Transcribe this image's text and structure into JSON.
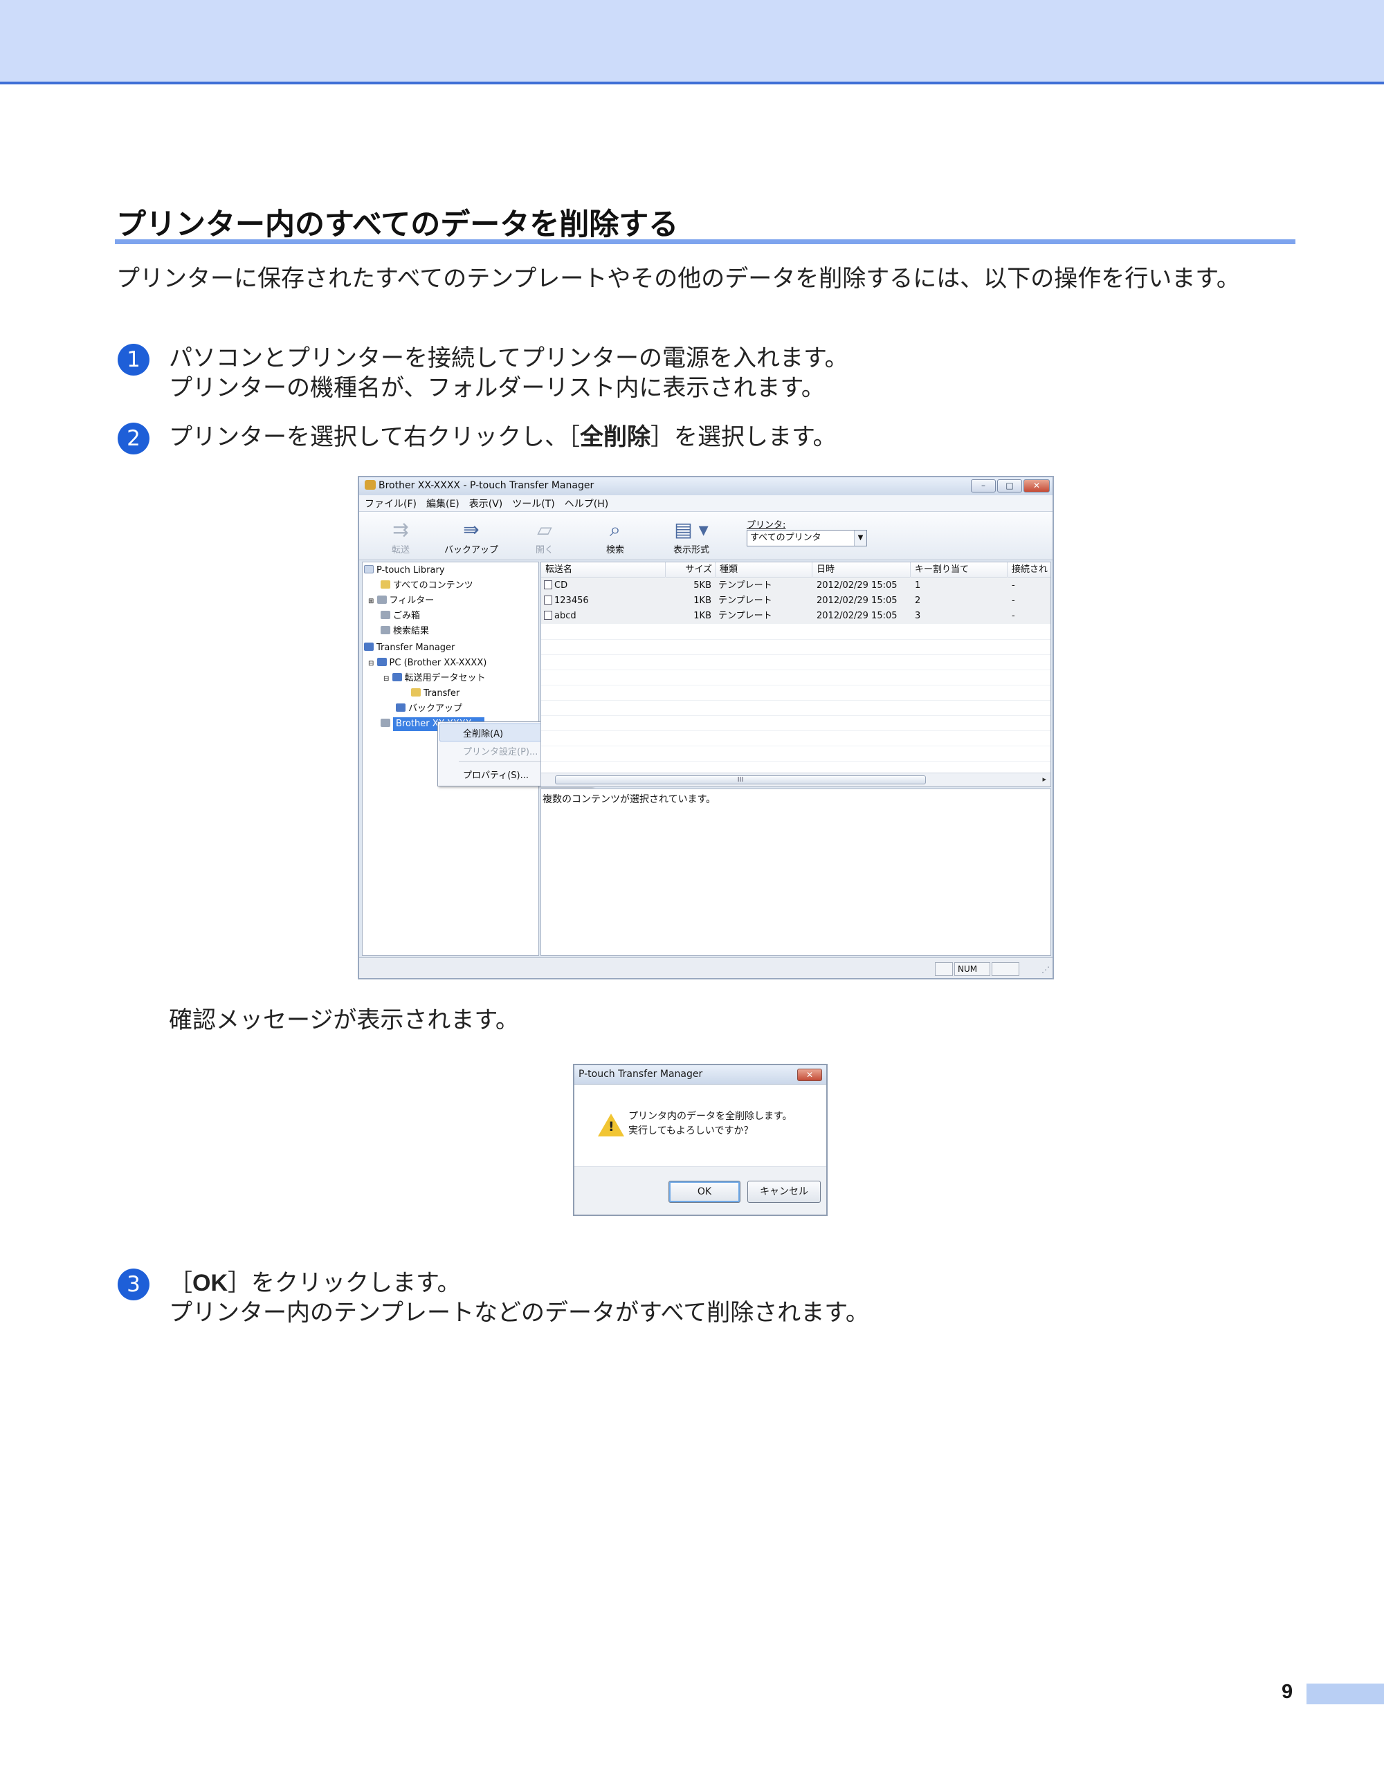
{
  "page": {
    "title": "プリンター内のすべてのデータを削除する",
    "intro": "プリンターに保存されたすべてのテンプレートやその他のデータを削除するには、以下の操作を行います。",
    "page_number": "9"
  },
  "steps": [
    {
      "num": "1",
      "line1": "パソコンとプリンターを接続してプリンターの電源を入れます。",
      "line2": "プリンターの機種名が、フォルダーリスト内に表示されます。"
    },
    {
      "num": "2",
      "pre": "プリンターを選択して右クリックし、［",
      "bold": "全削除",
      "post": "］を選択します。"
    },
    {
      "num": "3",
      "pre": "［",
      "bold": "OK",
      "post": "］をクリックします。",
      "line2": "プリンター内のテンプレートなどのデータがすべて削除されます。"
    }
  ],
  "confirm_text": "確認メッセージが表示されます。",
  "app": {
    "window_title": "Brother XX-XXXX - P-touch Transfer Manager",
    "window_buttons": [
      "–",
      "□",
      "✕"
    ],
    "menu": [
      "ファイル(F)",
      "編集(E)",
      "表示(V)",
      "ツール(T)",
      "ヘルプ(H)"
    ],
    "toolbar": {
      "transfer": "転送",
      "backup": "バックアップ",
      "open": "開く",
      "search": "検索",
      "view": "表示形式",
      "printer_label": "プリンタ:",
      "printer_value": "すべてのプリンタ"
    },
    "tree": {
      "library": "P-touch Library",
      "all_contents": "すべてのコンテンツ",
      "filter": "フィルター",
      "trash": "ごみ箱",
      "search_results": "検索結果",
      "transfer_manager": "Transfer Manager",
      "pc": "PC (Brother XX-XXXX)",
      "dataset": "転送用データセット",
      "transfer": "Transfer",
      "backup": "バックアップ",
      "printer": "Brother XX-XXXX"
    },
    "context_menu": {
      "delete_all": "全削除(A)",
      "printer_settings": "プリンタ設定(P)...",
      "properties": "プロパティ(S)..."
    },
    "list": {
      "columns": [
        "転送名",
        "サイズ",
        "種類",
        "日時",
        "キー割り当て",
        "接続され"
      ],
      "rows": [
        [
          "CD",
          "5KB",
          "テンプレート",
          "2012/02/29 15:05",
          "1",
          "-"
        ],
        [
          "123456",
          "1KB",
          "テンプレート",
          "2012/02/29 15:05",
          "2",
          "-"
        ],
        [
          "abcd",
          "1KB",
          "テンプレート",
          "2012/02/29 15:05",
          "3",
          "-"
        ]
      ],
      "scroll_grip": "III"
    },
    "detail_text": "複数のコンテンツが選択されています。",
    "status_num": "NUM"
  },
  "dialog": {
    "title": "P-touch Transfer Manager",
    "close": "✕",
    "message_line1": "プリンタ内のデータを全削除します。",
    "message_line2": "実行してもよろしいですか？",
    "warning_glyph": "!",
    "ok": "OK",
    "cancel": "キャンセル"
  },
  "icons": {
    "transfer": "transfer-icon",
    "backup": "backup-icon",
    "open": "open-folder-icon",
    "search": "magnifier-icon",
    "view": "view-list-icon",
    "warning": "warning-icon"
  },
  "colors": {
    "band": "#cddcfa",
    "accent": "#3f6fd6",
    "step_circle": "#1e5fd8",
    "rule": "#7ea4ee"
  }
}
